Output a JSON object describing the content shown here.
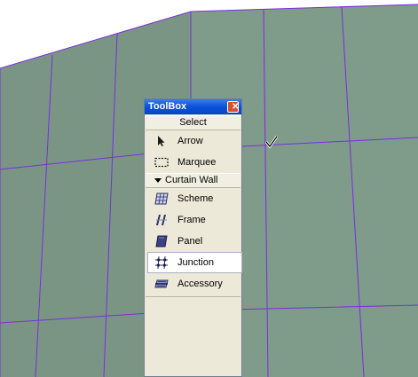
{
  "colors": {
    "wall_fill": "#7f9b89",
    "grid_line": "#7a2ee0",
    "title_bar": "#0a52d8",
    "panel_bg": "#ece9d8"
  },
  "toolbox": {
    "title": "ToolBox",
    "close_icon": "close-icon",
    "select_section": {
      "label": "Select",
      "tools": [
        {
          "label": "Arrow",
          "icon": "arrow-pointer-icon"
        },
        {
          "label": "Marquee",
          "icon": "marquee-icon"
        }
      ]
    },
    "curtain_wall_section": {
      "label": "Curtain Wall",
      "tools": [
        {
          "label": "Scheme",
          "icon": "scheme-icon"
        },
        {
          "label": "Frame",
          "icon": "frame-icon"
        },
        {
          "label": "Panel",
          "icon": "panel-icon"
        },
        {
          "label": "Junction",
          "icon": "junction-icon",
          "selected": true
        },
        {
          "label": "Accessory",
          "icon": "accessory-icon"
        }
      ]
    }
  }
}
